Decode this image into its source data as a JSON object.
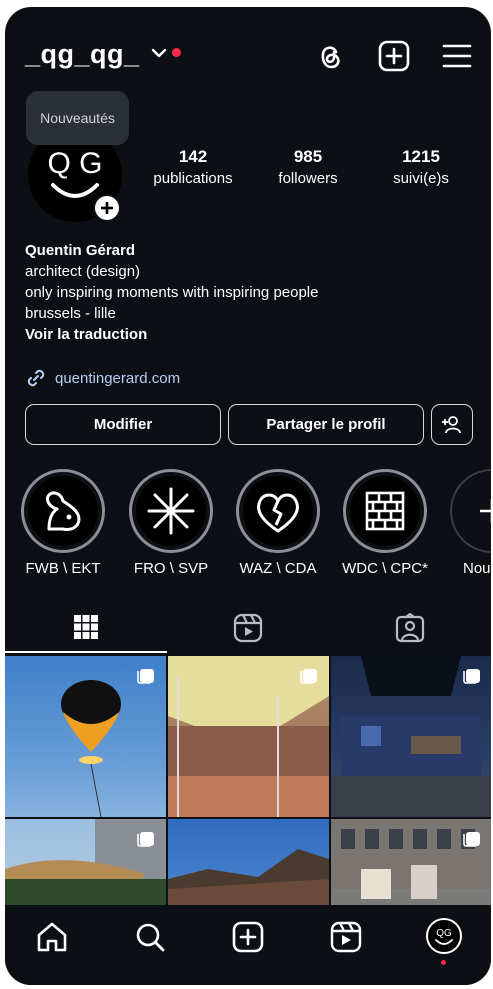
{
  "header": {
    "username": "_qg_qg_",
    "icons": [
      "chevron-down-icon",
      "threads-icon",
      "create-icon",
      "menu-icon"
    ]
  },
  "tooltip": "Nouveautés",
  "avatar": {
    "letters": "Q G",
    "small_letters": "QG"
  },
  "stats": [
    {
      "number": "142",
      "label": "publications"
    },
    {
      "number": "985",
      "label": "followers"
    },
    {
      "number": "1215",
      "label": "suivi(e)s"
    }
  ],
  "bio": {
    "name": "Quentin Gérard",
    "lines": [
      "architect (design)",
      "only inspiring moments with inspiring people",
      "brussels - lille"
    ],
    "translate": "Voir la traduction"
  },
  "link": "quentingerard.com",
  "buttons": {
    "edit": "Modifier",
    "share": "Partager le profil"
  },
  "highlights": [
    {
      "label": "FWB \\ EKT",
      "icon": "bird-icon"
    },
    {
      "label": "FRO \\ SVP",
      "icon": "asterisk-icon"
    },
    {
      "label": "WAZ \\ CDA",
      "icon": "broken-heart-icon"
    },
    {
      "label": "WDC \\ CPC*",
      "icon": "brick-wall-icon"
    },
    {
      "label": "Nouveau",
      "icon": "plus-icon"
    }
  ],
  "tabs": [
    "grid-icon",
    "reels-icon",
    "tagged-icon"
  ],
  "nav": [
    "home-icon",
    "search-icon",
    "create-icon",
    "reels-icon",
    "profile-avatar"
  ],
  "colors": {
    "background": "#0c0f14",
    "link": "#b7cff7",
    "notification": "#ff2a48"
  }
}
